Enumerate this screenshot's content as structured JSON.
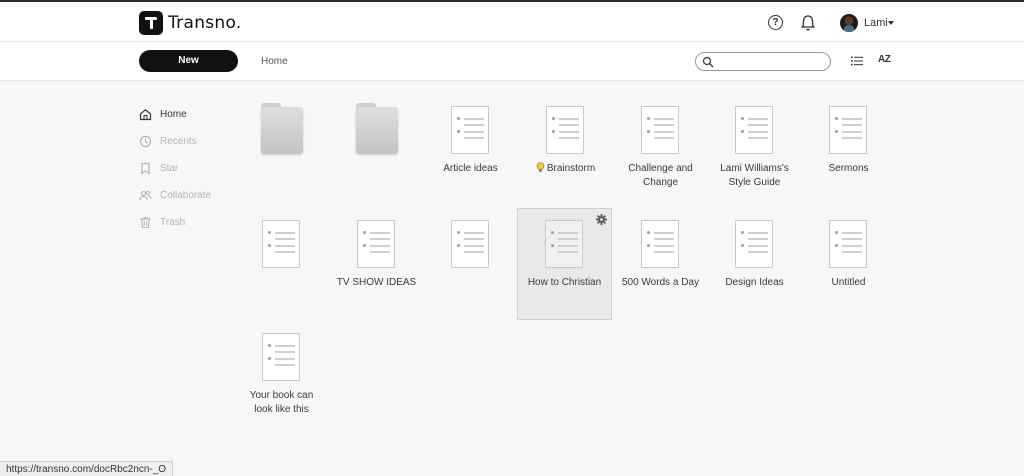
{
  "app": {
    "name": "Transno."
  },
  "header": {
    "user_name": "Lami",
    "help_icon": "help-circle-icon",
    "bell_icon": "bell-icon"
  },
  "toolbar": {
    "new_label": "New",
    "breadcrumb": "Home",
    "search_placeholder": "",
    "search_value": "",
    "sort_label": "AZ"
  },
  "sidebar": {
    "items": [
      {
        "label": "Home",
        "icon": "home-icon",
        "active": true
      },
      {
        "label": "Recents",
        "icon": "clock-icon",
        "active": false
      },
      {
        "label": "Star",
        "icon": "bookmark-icon",
        "active": false
      },
      {
        "label": "Collaborate",
        "icon": "people-icon",
        "active": false
      },
      {
        "label": "Trash",
        "icon": "trash-icon",
        "active": false
      }
    ]
  },
  "grid": {
    "items": [
      {
        "type": "folder",
        "label": ""
      },
      {
        "type": "folder",
        "label": ""
      },
      {
        "type": "doc",
        "label": "Article ideas"
      },
      {
        "type": "doc",
        "label": "Brainstorm",
        "prefix_icon": "lightbulb-icon"
      },
      {
        "type": "doc",
        "label": "Challenge and Change"
      },
      {
        "type": "doc",
        "label": "Lami Williams's Style Guide"
      },
      {
        "type": "doc",
        "label": "Sermons"
      },
      {
        "type": "doc",
        "label": ""
      },
      {
        "type": "doc",
        "label": "TV SHOW IDEAS"
      },
      {
        "type": "doc",
        "label": ""
      },
      {
        "type": "doc",
        "label": "How to Christian",
        "selected": true,
        "action_icon": "gear-icon"
      },
      {
        "type": "doc",
        "label": "500 Words a Day"
      },
      {
        "type": "doc",
        "label": "Design Ideas"
      },
      {
        "type": "doc",
        "label": "Untitled"
      },
      {
        "type": "doc",
        "label": "Your book can look like this"
      }
    ]
  },
  "status_bar": {
    "url": "https://transno.com/docRbc2ncn-_O"
  },
  "colors": {
    "accent": "#111111",
    "background": "#f7f7f8",
    "inactive_text": "#b4b4b4"
  }
}
